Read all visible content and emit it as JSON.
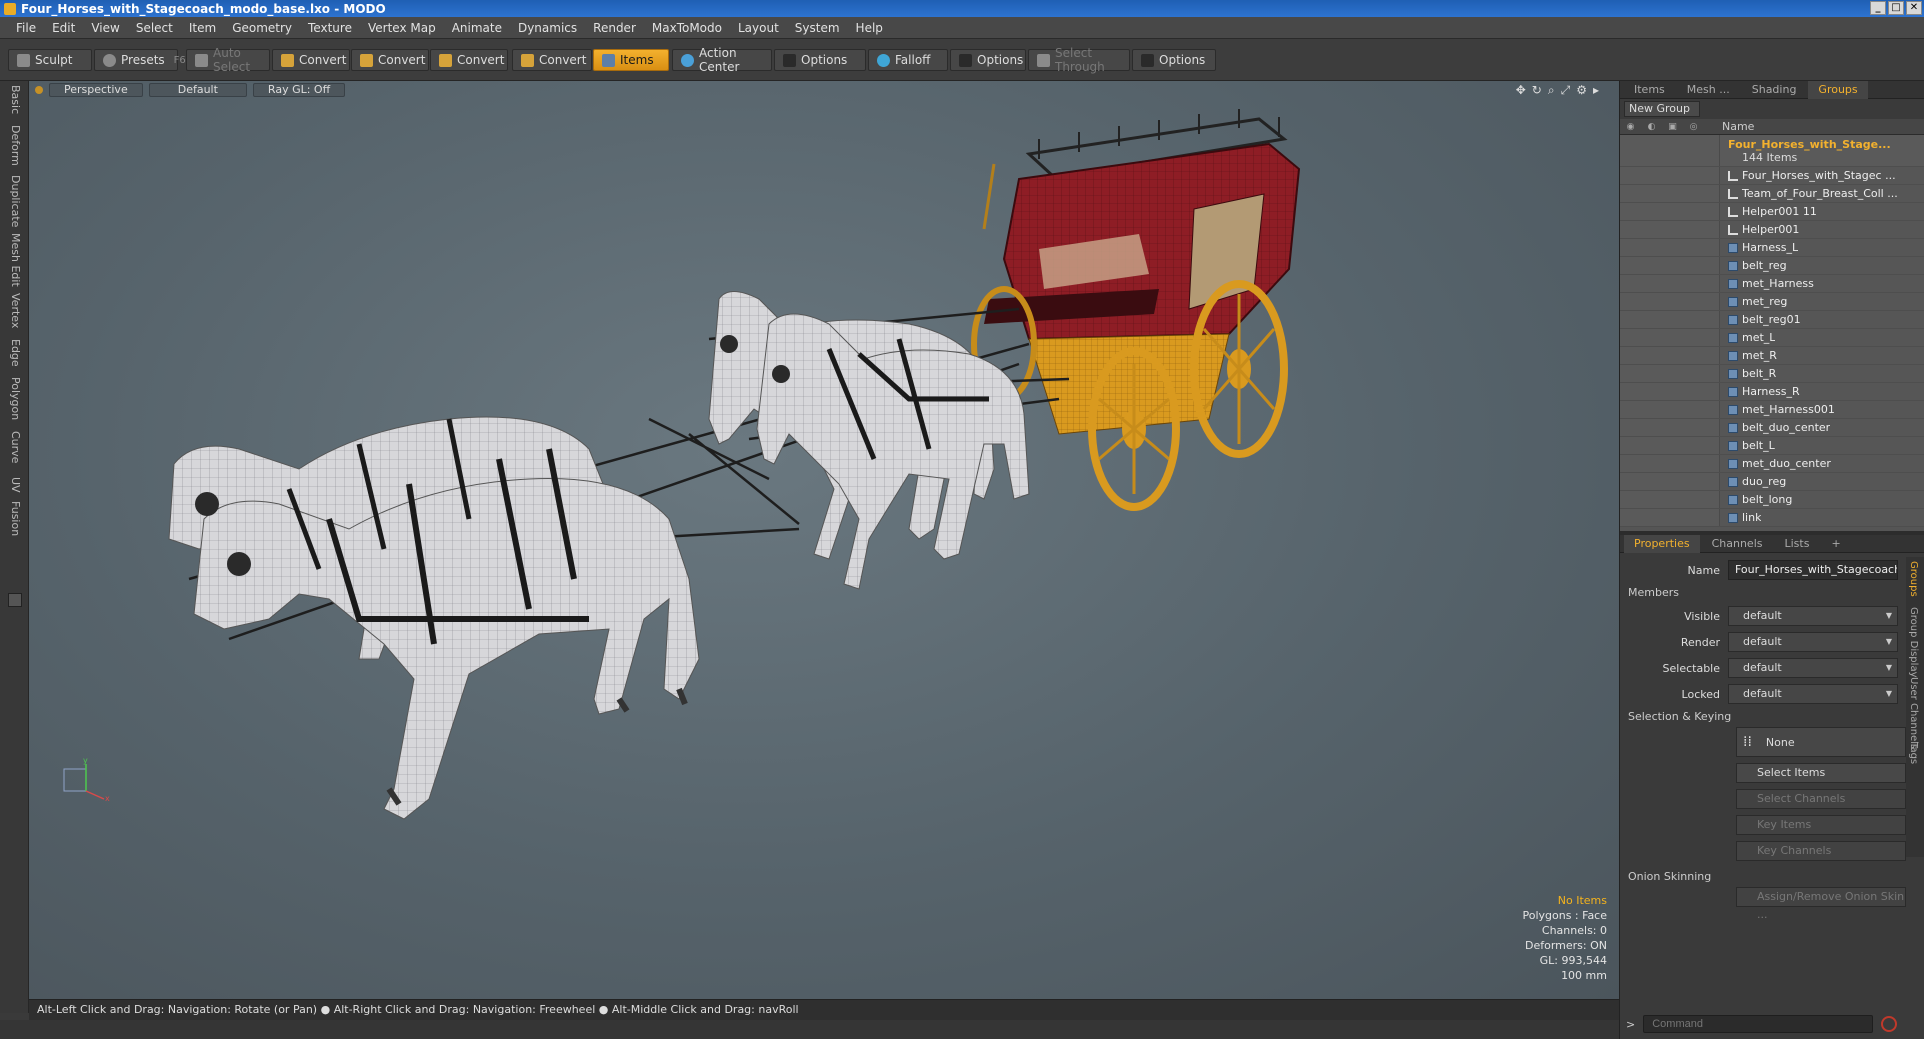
{
  "window": {
    "title": "Four_Horses_with_Stagecoach_modo_base.lxo - MODO",
    "controls": [
      "_",
      "□",
      "✕"
    ]
  },
  "menu": [
    "File",
    "Edit",
    "View",
    "Select",
    "Item",
    "Geometry",
    "Texture",
    "Vertex Map",
    "Animate",
    "Dynamics",
    "Render",
    "MaxToModo",
    "Layout",
    "System",
    "Help"
  ],
  "toolbar": {
    "sculpt": "Sculpt",
    "presets": "Presets",
    "presets_hotkey": "F6",
    "auto_select": "Auto Select",
    "convert1": "Convert",
    "convert2": "Convert",
    "convert3": "Convert",
    "convert4": "Convert",
    "items": "Items",
    "action_center": "Action Center",
    "options1": "Options",
    "falloff": "Falloff",
    "options2": "Options",
    "select_through": "Select Through",
    "options3": "Options"
  },
  "left_tabs": [
    "Basic",
    "Deform",
    "Duplicate",
    "Mesh Edit",
    "Vertex",
    "Edge",
    "Polygon",
    "Curve",
    "UV",
    "Fusion"
  ],
  "viewport": {
    "view": "Perspective",
    "shading": "Default",
    "raygl": "Ray GL: Off",
    "hud": {
      "items": "No Items",
      "polygons": "Polygons : Face",
      "channels": "Channels: 0",
      "deformers": "Deformers: ON",
      "gl": "GL: 993,544",
      "scale": "100 mm"
    }
  },
  "status": "Alt-Left Click and Drag: Navigation: Rotate (or Pan) ● Alt-Right Click and Drag: Navigation: Freewheel ● Alt-Middle Click and Drag: navRoll",
  "panel_tabs": {
    "items": "Items",
    "mesh": "Mesh ...",
    "shading": "Shading",
    "groups": "Groups"
  },
  "groups": {
    "new_group": "New Group",
    "name_col": "Name",
    "top": {
      "name": "Four_Horses_with_Stage...",
      "count": "144 Items"
    },
    "items": [
      {
        "name": "Four_Horses_with_Stagec ...",
        "kind": "locator"
      },
      {
        "name": "Team_of_Four_Breast_Coll ...",
        "kind": "locator"
      },
      {
        "name": "Helper001 11",
        "kind": "locator"
      },
      {
        "name": "Helper001",
        "kind": "locator"
      },
      {
        "name": "Harness_L",
        "kind": "mesh"
      },
      {
        "name": "belt_reg",
        "kind": "mesh"
      },
      {
        "name": "met_Harness",
        "kind": "mesh"
      },
      {
        "name": "met_reg",
        "kind": "mesh"
      },
      {
        "name": "belt_reg01",
        "kind": "mesh"
      },
      {
        "name": "met_L",
        "kind": "mesh"
      },
      {
        "name": "met_R",
        "kind": "mesh"
      },
      {
        "name": "belt_R",
        "kind": "mesh"
      },
      {
        "name": "Harness_R",
        "kind": "mesh"
      },
      {
        "name": "met_Harness001",
        "kind": "mesh"
      },
      {
        "name": "belt_duo_center",
        "kind": "mesh"
      },
      {
        "name": "belt_L",
        "kind": "mesh"
      },
      {
        "name": "met_duo_center",
        "kind": "mesh"
      },
      {
        "name": "duo_reg",
        "kind": "mesh"
      },
      {
        "name": "belt_long",
        "kind": "mesh"
      },
      {
        "name": "link",
        "kind": "mesh"
      }
    ]
  },
  "prop_tabs": {
    "properties": "Properties",
    "channels": "Channels",
    "lists": "Lists",
    "add": "+"
  },
  "properties": {
    "name_label": "Name",
    "name_value": "Four_Horses_with_Stagecoach (",
    "members": "Members",
    "visible_label": "Visible",
    "visible": "default",
    "render_label": "Render",
    "render": "default",
    "selectable_label": "Selectable",
    "selectable": "default",
    "locked_label": "Locked",
    "locked": "default",
    "selection_keying": "Selection & Keying",
    "none": "None",
    "select_items": "Select Items",
    "select_channels": "Select Channels",
    "key_items": "Key Items",
    "key_channels": "Key Channels",
    "onion": "Onion Skinning",
    "assign_onion": "Assign/Remove Onion Skin ..."
  },
  "side_tabs": [
    "Groups",
    "Group Display",
    "User Channels",
    "Tags"
  ],
  "command": {
    "placeholder": "Command",
    "prompt": ">"
  },
  "colors": {
    "accent": "#f3b12e",
    "coach_red": "#8e1d25",
    "wheel_yellow": "#d99a1f",
    "horse": "#d9d9dc"
  }
}
